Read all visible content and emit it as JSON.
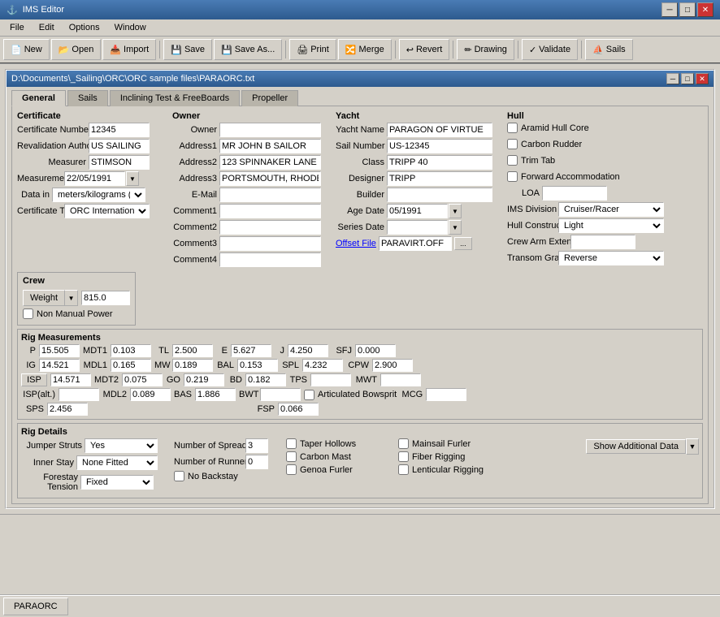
{
  "window": {
    "title": "IMS Editor",
    "document_path": "D:\\Documents\\_Sailing\\ORC\\ORC sample files\\PARAORC.txt"
  },
  "menu": {
    "items": [
      "File",
      "Edit",
      "Options",
      "Window"
    ]
  },
  "toolbar": {
    "buttons": [
      "New",
      "Open",
      "Import",
      "Save",
      "Save As...",
      "Print",
      "Merge",
      "Revert",
      "Drawing",
      "Validate",
      "Sails"
    ]
  },
  "tabs": {
    "items": [
      "General",
      "Sails",
      "Inclining Test & FreeBoards",
      "Propeller"
    ],
    "active": 0
  },
  "certificate": {
    "label": "Certificate",
    "cert_number_label": "Certificate Number",
    "cert_number": "12345",
    "reval_auth_label": "Revalidation Authority",
    "reval_auth": "US SAILING",
    "measurer_label": "Measurer",
    "measurer": "STIMSON",
    "measurement_label": "Measurement",
    "measurement": "22/05/1991",
    "data_in_label": "Data in",
    "data_in": "meters/kilograms (Me",
    "cert_type_label": "Certificate Type",
    "cert_type": "ORC International"
  },
  "owner": {
    "label": "Owner",
    "owner_label": "Owner",
    "owner": "",
    "addr1_label": "Address1",
    "addr1": "MR JOHN B SAILOR",
    "addr2_label": "Address2",
    "addr2": "123 SPINNAKER LANE",
    "addr3_label": "Address3",
    "addr3": "PORTSMOUTH, RHODE I:",
    "email_label": "E-Mail",
    "email": "",
    "comment1_label": "Comment1",
    "comment1": "",
    "comment2_label": "Comment2",
    "comment2": "",
    "comment3_label": "Comment3",
    "comment3": "",
    "comment4_label": "Comment4",
    "comment4": ""
  },
  "yacht": {
    "label": "Yacht",
    "name_label": "Yacht Name",
    "name": "PARAGON OF VIRTUE",
    "sail_num_label": "Sail Number",
    "sail_num": "US-12345",
    "class_label": "Class",
    "class": "TRIPP 40",
    "designer_label": "Designer",
    "designer": "TRIPP",
    "builder_label": "Builder",
    "builder": "",
    "age_date_label": "Age Date",
    "age_date": "05/1991",
    "series_date_label": "Series Date",
    "series_date": "",
    "offset_file_label": "Offset File",
    "offset_file": "PARAVIRT.OFF"
  },
  "hull": {
    "label": "Hull",
    "aramid_label": "Aramid Hull Core",
    "carbon_label": "Carbon Rudder",
    "trim_label": "Trim Tab",
    "forward_label": "Forward Accommodation",
    "loa_label": "LOA",
    "loa": "",
    "ims_div_label": "IMS Division",
    "ims_div": "Cruiser/Racer",
    "hull_const_label": "Hull Construction",
    "hull_const": "Light",
    "crew_arm_label": "Crew Arm Extension",
    "crew_arm": "",
    "transom_label": "Transom Graphic",
    "transom": "Reverse"
  },
  "crew": {
    "label": "Crew",
    "weight_btn": "Weight",
    "weight_value": "815.0",
    "non_manual_label": "Non Manual Power"
  },
  "rig": {
    "label": "Rig Measurements",
    "p": "15.505",
    "mdt1": "0.103",
    "tl": "2.500",
    "e": "5.627",
    "j": "4.250",
    "sfj": "0.000",
    "ig": "14.521",
    "mdl1": "0.165",
    "mw": "0.189",
    "bal": "0.153",
    "spl": "4.232",
    "cpw": "2.900",
    "isp": "14.571",
    "mdt2": "0.075",
    "go": "0.219",
    "bd": "0.182",
    "tps": "",
    "mwt": "",
    "isp_alt": "",
    "mdl2": "0.089",
    "bas": "1.886",
    "bwt": "",
    "articulated": "Articulated Bowsprit",
    "mcg": "",
    "sps": "2.456",
    "fsp": "0.066"
  },
  "rig_details": {
    "label": "Rig Details",
    "jumper_struts_label": "Jumper Struts",
    "jumper_struts": "Yes",
    "num_spreaders_label": "Number of Spreaders",
    "num_spreaders": "3",
    "taper_hollows_label": "Taper Hollows",
    "inner_stay_label": "Inner Stay",
    "inner_stay": "None Fitted",
    "num_runners_label": "Number of Runners",
    "num_runners": "0",
    "carbon_mast_label": "Carbon Mast",
    "mainsail_furler_label": "Mainsail Furler",
    "forestay_tension_label": "Forestay Tension",
    "forestay_tension": "Fixed",
    "no_backstay_label": "No Backstay",
    "genoa_furler_label": "Genoa Furler",
    "fiber_rigging_label": "Fiber Rigging",
    "lenticular_label": "Lenticular Rigging",
    "show_additional_label": "Show Additional Data"
  },
  "taskbar": {
    "item": "PARAORC"
  }
}
